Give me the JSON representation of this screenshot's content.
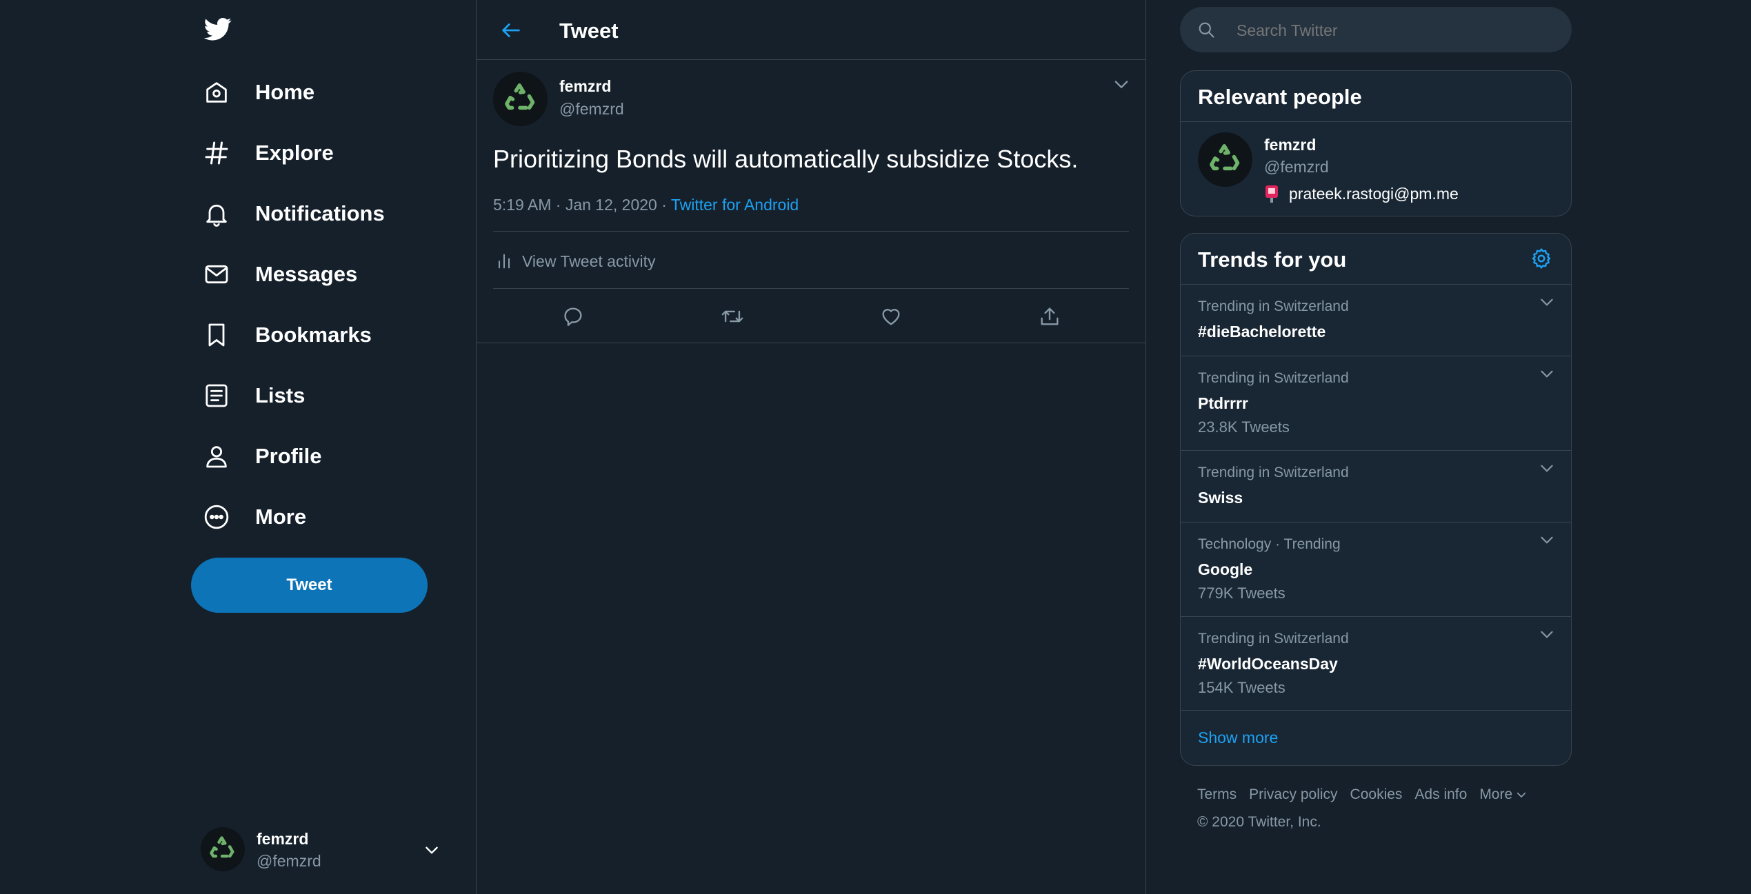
{
  "nav": {
    "items": [
      {
        "label": "Home",
        "icon": "home-icon"
      },
      {
        "label": "Explore",
        "icon": "hashtag-icon"
      },
      {
        "label": "Notifications",
        "icon": "bell-icon"
      },
      {
        "label": "Messages",
        "icon": "envelope-icon"
      },
      {
        "label": "Bookmarks",
        "icon": "bookmark-icon"
      },
      {
        "label": "Lists",
        "icon": "list-icon"
      },
      {
        "label": "Profile",
        "icon": "person-icon"
      },
      {
        "label": "More",
        "icon": "more-circle-icon"
      }
    ],
    "tweet_button": "Tweet"
  },
  "account": {
    "name": "femzrd",
    "handle": "@femzrd"
  },
  "main": {
    "header_title": "Tweet",
    "tweet": {
      "author_name": "femzrd",
      "author_handle": "@femzrd",
      "text": "Prioritizing Bonds will automatically subsidize Stocks.",
      "time": "5:19 AM · Jan 12, 2020 · ",
      "source": "Twitter for Android",
      "activity_label": "View Tweet activity"
    }
  },
  "search": {
    "placeholder": "Search Twitter"
  },
  "relevant_people": {
    "title": "Relevant people",
    "name": "femzrd",
    "handle": "@femzrd",
    "bio": "prateek.rastogi@pm.me"
  },
  "trends": {
    "title": "Trends for you",
    "items": [
      {
        "context": "Trending in Switzerland",
        "name": "#dieBachelorette",
        "count": ""
      },
      {
        "context": "Trending in Switzerland",
        "name": "Ptdrrrr",
        "count": "23.8K Tweets"
      },
      {
        "context": "Trending in Switzerland",
        "name": "Swiss",
        "count": ""
      },
      {
        "context": "Technology · Trending",
        "name": "Google",
        "count": "779K Tweets"
      },
      {
        "context": "Trending in Switzerland",
        "name": "#WorldOceansDay",
        "count": "154K Tweets"
      }
    ],
    "show_more": "Show more"
  },
  "footer": {
    "links": [
      "Terms",
      "Privacy policy",
      "Cookies",
      "Ads info",
      "More"
    ],
    "copyright": "© 2020 Twitter, Inc."
  },
  "colors": {
    "background": "#15202b",
    "card": "#192734",
    "accent": "#1da1f2",
    "border": "#38444d",
    "muted": "#8899a6",
    "recycle_green": "#6fb36b"
  }
}
